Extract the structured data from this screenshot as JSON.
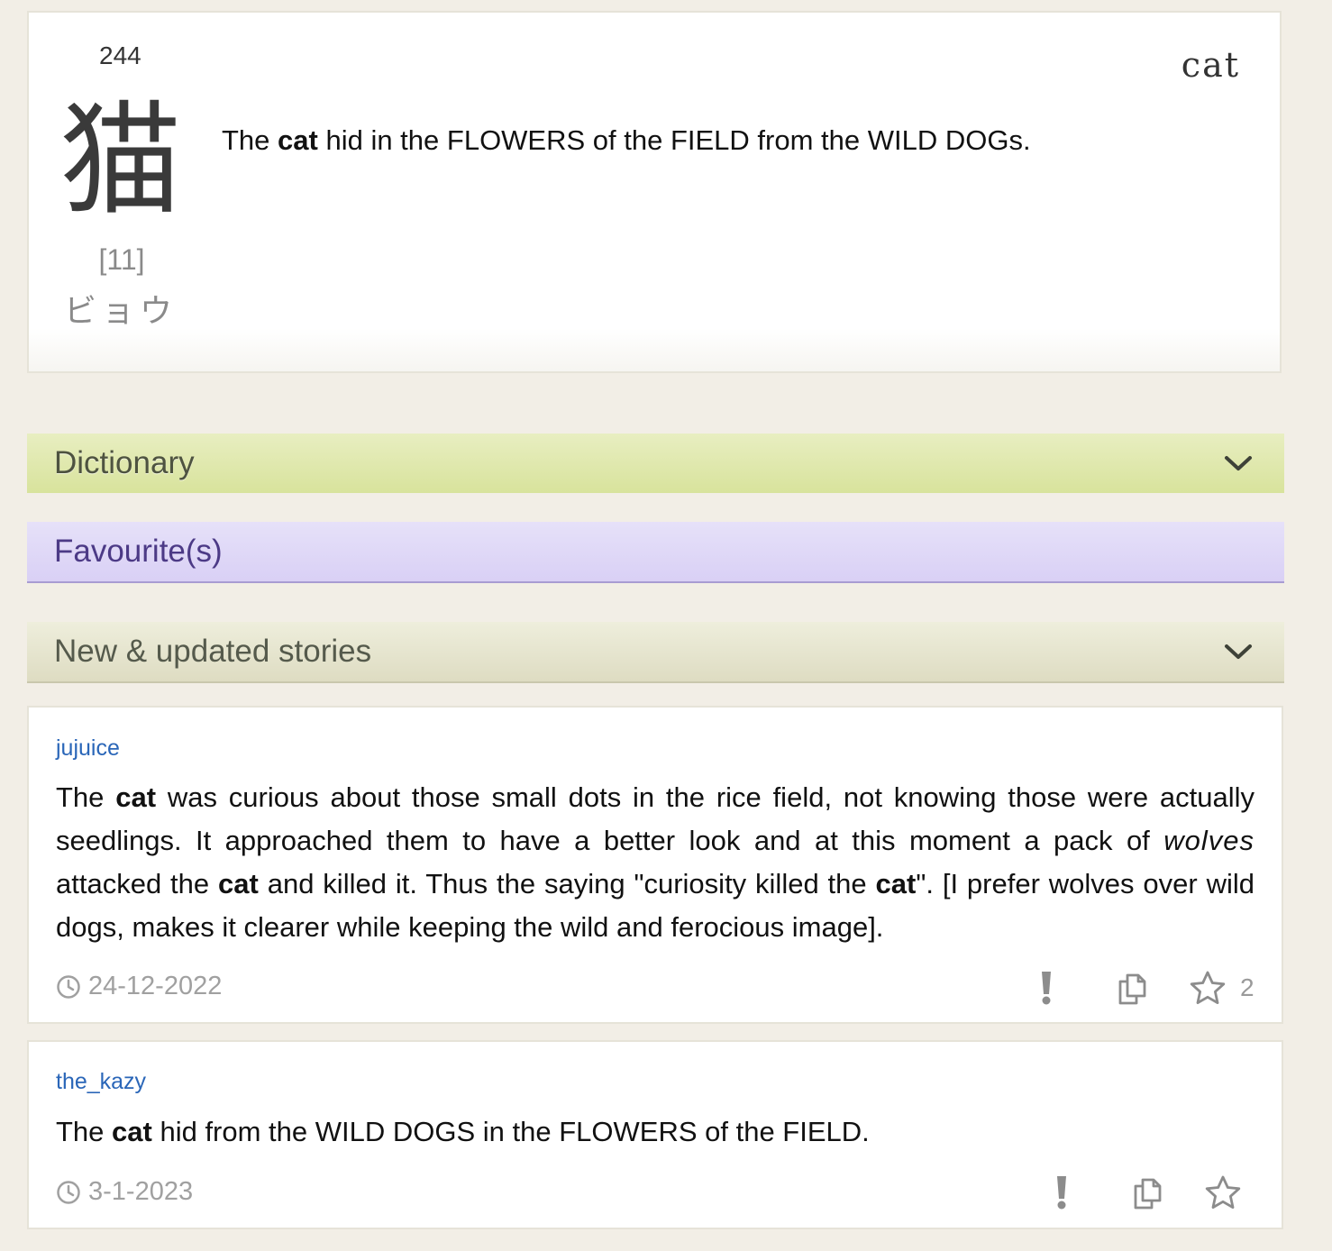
{
  "kanji_card": {
    "frame_number": "244",
    "keyword": "cat",
    "kanji": "猫",
    "stroke_count": "[11]",
    "reading": "ビョウ",
    "story": {
      "part1": "The ",
      "bold": "cat",
      "part2": " hid in the FLOWERS of the FIELD from the WILD DOGs."
    }
  },
  "sections": {
    "dictionary": "Dictionary",
    "favourites": "Favourite(s)",
    "new_updated": "New & updated stories"
  },
  "stories": [
    {
      "author": "jujuice",
      "text": {
        "s1": "The ",
        "b1": "cat",
        "s2": " was curious about those small dots in the rice field, not knowing those were actually seedlings. It approached them to have a better look and at this moment a pack of ",
        "i1": "wolves",
        "s3": " attacked the ",
        "b2": "cat",
        "s4": " and killed it. Thus the saying \"curiosity killed the ",
        "b3": "cat",
        "s5": "\". [I prefer wolves over wild dogs, makes it clearer while keeping the wild and ferocious image]."
      },
      "date": "24-12-2022",
      "star_count": "2"
    },
    {
      "author": "the_kazy",
      "text": {
        "s1": "The ",
        "b1": "cat",
        "s2": " hid from the WILD DOGS in the FLOWERS of the FIELD."
      },
      "date": "3-1-2023",
      "star_count": ""
    }
  ],
  "icons": {
    "report": "exclamation-icon",
    "copy": "copy-icon",
    "star": "star-outline-icon",
    "clock": "clock-icon",
    "chevron": "chevron-down-icon"
  },
  "colors": {
    "background": "#f2eee6",
    "author_link": "#2a66b8",
    "dictionary_bar": "#d8e39c",
    "favourites_bar": "#d9d0f5",
    "stories_bar": "#dedcc2"
  }
}
